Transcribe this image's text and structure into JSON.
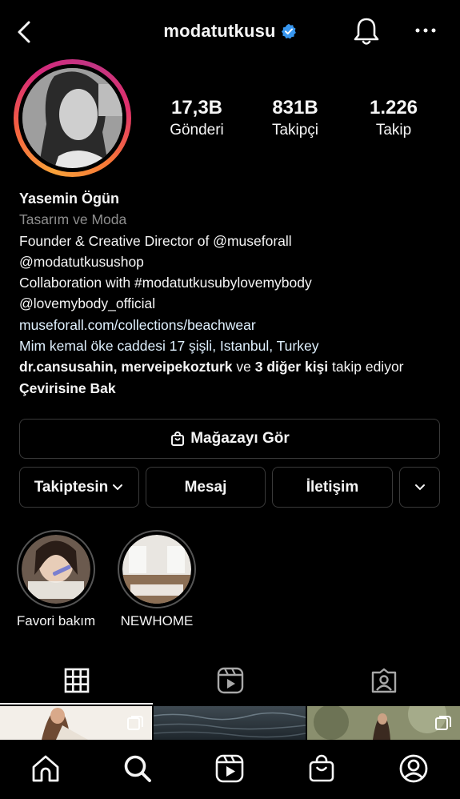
{
  "header": {
    "username": "modatutkusu",
    "verified": true,
    "icons": [
      "back-icon",
      "verified-badge-icon",
      "bell-icon",
      "more-icon"
    ]
  },
  "stats": [
    {
      "value": "17,3B",
      "label": "Gönderi"
    },
    {
      "value": "831B",
      "label": "Takipçi"
    },
    {
      "value": "1.226",
      "label": "Takip"
    }
  ],
  "bio": {
    "name": "Yasemin Ögün",
    "category": "Tasarım ve Moda",
    "line1": "Founder & Creative Director of @museforall",
    "line2": "@modatutkusushop",
    "line3": "Collaboration with #modatutkusubylovemybody",
    "line4": "@lovemybody_official",
    "link": "museforall.com/collections/beachwear",
    "address": "Mim kemal öke caddesi 17 şişli, Istanbul, Turkey",
    "followed_by_names": "dr.cansusahin, merveipekozturk",
    "followed_by_and": " ve ",
    "followed_by_others": "3 diğer kişi",
    "followed_by_suffix": " takip ediyor",
    "translate": "Çevirisine Bak"
  },
  "buttons": {
    "shop": "Mağazayı Gör",
    "following": "Takiptesin",
    "message": "Mesaj",
    "contact": "İletişim"
  },
  "highlights": [
    {
      "label": "Favori bakım"
    },
    {
      "label": "NEWHOME"
    }
  ],
  "tabs": [
    "grid-icon",
    "reels-icon",
    "tagged-icon"
  ],
  "bottom_nav": [
    "home-icon",
    "search-icon",
    "reels-icon",
    "shop-icon",
    "profile-icon"
  ],
  "colors": {
    "background": "#000000",
    "verified": "#3897f0",
    "text": "#f5f5f5",
    "muted": "#8e8e8e"
  }
}
